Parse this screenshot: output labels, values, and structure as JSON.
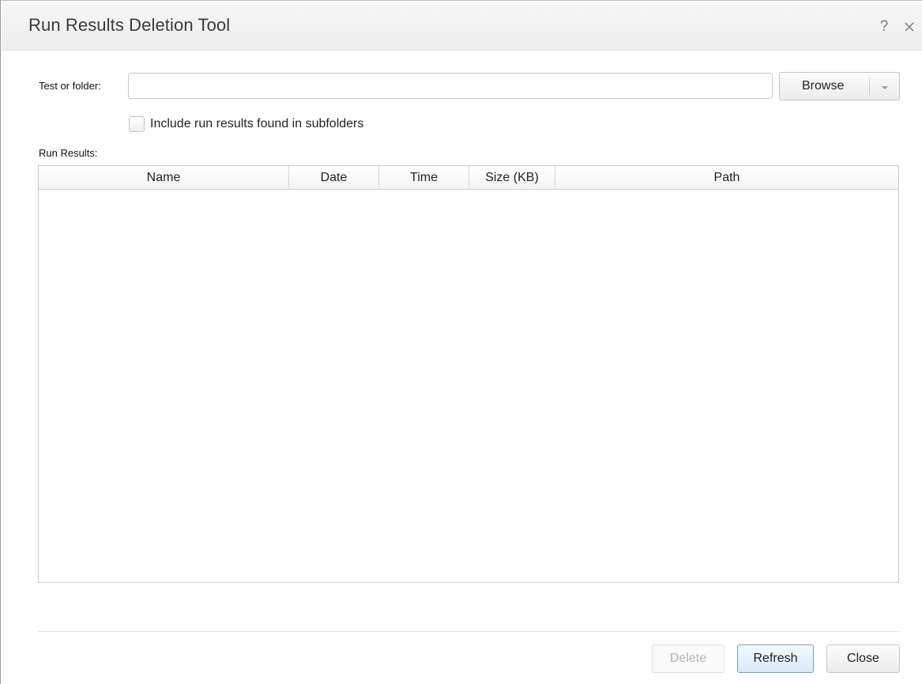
{
  "dialog": {
    "title": "Run Results Deletion Tool",
    "help_glyph": "?",
    "close_icon": "close-icon"
  },
  "form": {
    "test_or_folder_label": "Test or folder:",
    "test_or_folder_value": "",
    "browse_label": "Browse",
    "browse_dropdown_icon": "chevron-down-icon",
    "include_subfolders_label": "Include run results found in subfolders",
    "include_subfolders_checked": false
  },
  "results": {
    "label": "Run Results:",
    "columns": [
      "Name",
      "Date",
      "Time",
      "Size (KB)",
      "Path"
    ],
    "rows": []
  },
  "footer": {
    "delete_label": "Delete",
    "refresh_label": "Refresh",
    "close_label": "Close"
  },
  "colors": {
    "accent_border": "#6f9fd1",
    "disabled_text": "#b5b5b5"
  }
}
